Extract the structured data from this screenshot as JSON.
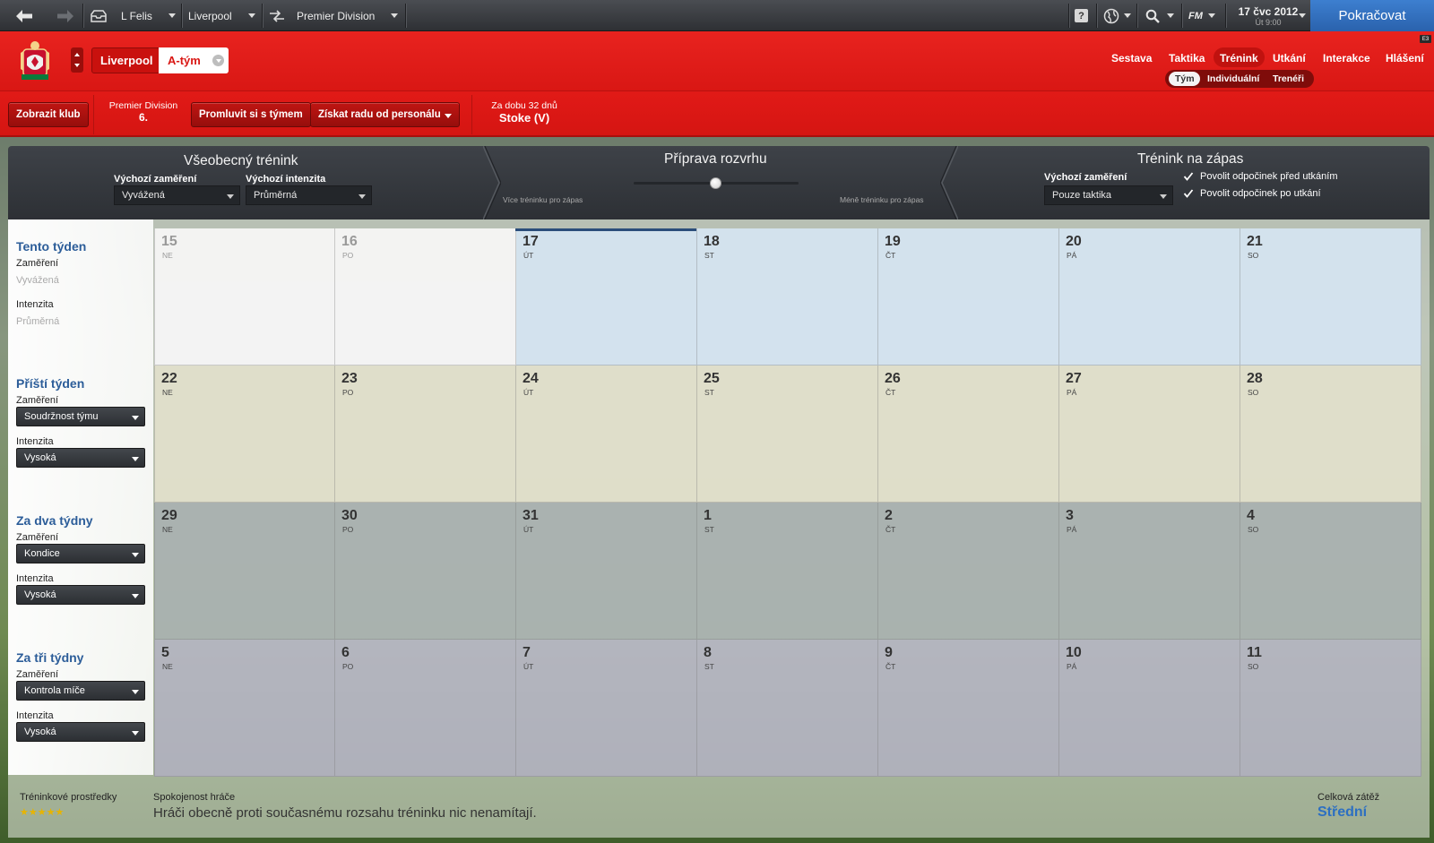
{
  "topbar": {
    "manager": "L Felis",
    "club": "Liverpool",
    "league": "Premier Division",
    "date": "17 čvc 2012",
    "time": "Út 9:00",
    "fm_label": "FM",
    "help_label": "?",
    "continue_label": "Pokračovat"
  },
  "clubbar": {
    "club_tab": "Liverpool",
    "team_tab": "A-tým",
    "nav": [
      "Sestava",
      "Taktika",
      "Trénink",
      "Utkání",
      "Interakce",
      "Hlášení"
    ],
    "subnav": [
      "Tým",
      "Individuální",
      "Trenéři"
    ],
    "corner_badge": "E3"
  },
  "subbar": {
    "view_club": "Zobrazit klub",
    "league": "Premier Division",
    "position": "6.",
    "talk_team": "Promluvit si s týmem",
    "staff_advice": "Získat radu od personálu",
    "next_label": "Za dobu 32 dnů",
    "next_opponent": "Stoke (V)"
  },
  "general_training": {
    "title": "Všeobecný trénink",
    "focus_label": "Výchozí zaměření",
    "focus_value": "Vyvážená",
    "intensity_label": "Výchozí intenzita",
    "intensity_value": "Průměrná"
  },
  "schedule_prep": {
    "title": "Příprava rozvrhu",
    "left_label": "Více tréninku pro zápas",
    "right_label": "Méně tréninku pro zápas",
    "slider_position": 0.5
  },
  "match_training": {
    "title": "Trénink na zápas",
    "focus_label": "Výchozí zaměření",
    "focus_value": "Pouze taktika",
    "rest_before": "Povolit odpočinek před utkáním",
    "rest_after": "Povolit odpočinek po utkání"
  },
  "weeks": [
    {
      "title": "Tento týden",
      "focus_label": "Zaměření",
      "focus_value": "Vyvážená",
      "intensity_label": "Intenzita",
      "intensity_value": "Průměrná",
      "disabled": true,
      "days": [
        [
          "15",
          "NE"
        ],
        [
          "16",
          "PO"
        ],
        [
          "17",
          "ÚT"
        ],
        [
          "18",
          "ST"
        ],
        [
          "19",
          "ČT"
        ],
        [
          "20",
          "PÁ"
        ],
        [
          "21",
          "SO"
        ]
      ]
    },
    {
      "title": "Příští týden",
      "focus_label": "Zaměření",
      "focus_value": "Soudržnost týmu",
      "intensity_label": "Intenzita",
      "intensity_value": "Vysoká",
      "disabled": false,
      "days": [
        [
          "22",
          "NE"
        ],
        [
          "23",
          "PO"
        ],
        [
          "24",
          "ÚT"
        ],
        [
          "25",
          "ST"
        ],
        [
          "26",
          "ČT"
        ],
        [
          "27",
          "PÁ"
        ],
        [
          "28",
          "SO"
        ]
      ]
    },
    {
      "title": "Za dva týdny",
      "focus_label": "Zaměření",
      "focus_value": "Kondice",
      "intensity_label": "Intenzita",
      "intensity_value": "Vysoká",
      "disabled": false,
      "days": [
        [
          "29",
          "NE"
        ],
        [
          "30",
          "PO"
        ],
        [
          "31",
          "ÚT"
        ],
        [
          "1",
          "ST"
        ],
        [
          "2",
          "ČT"
        ],
        [
          "3",
          "PÁ"
        ],
        [
          "4",
          "SO"
        ]
      ]
    },
    {
      "title": "Za tři týdny",
      "focus_label": "Zaměření",
      "focus_value": "Kontrola míče",
      "intensity_label": "Intenzita",
      "intensity_value": "Vysoká",
      "disabled": false,
      "days": [
        [
          "5",
          "NE"
        ],
        [
          "6",
          "PO"
        ],
        [
          "7",
          "ÚT"
        ],
        [
          "8",
          "ST"
        ],
        [
          "9",
          "ČT"
        ],
        [
          "10",
          "PÁ"
        ],
        [
          "11",
          "SO"
        ]
      ]
    }
  ],
  "footer": {
    "facilities_label": "Tréninkové prostředky",
    "facilities_stars": "★★★★★",
    "satisfaction_label": "Spokojenost hráče",
    "satisfaction_text": "Hráči obecně proti současnému rozsahu tréninku nic nenamítají.",
    "workload_label": "Celková zátěž",
    "workload_value": "Střední"
  },
  "colors": {
    "brand_red": "#e01d1a",
    "continue_blue": "#2f6fc0",
    "week_title_blue": "#2c5d99"
  }
}
